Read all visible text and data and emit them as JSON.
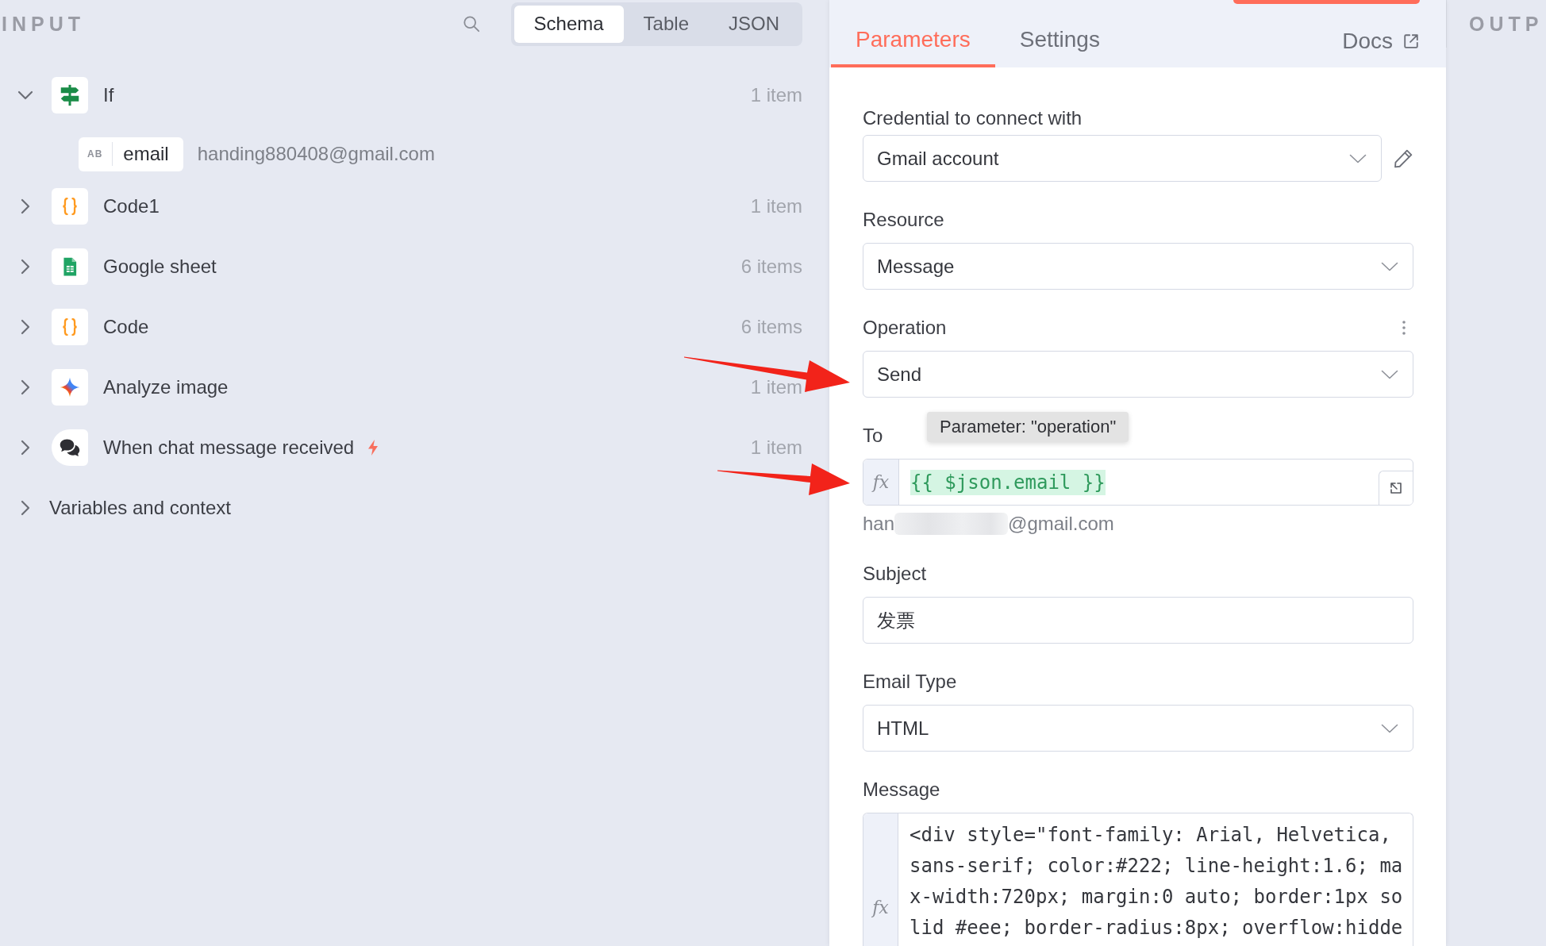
{
  "input_panel": {
    "title": "INPUT",
    "view_tabs": [
      {
        "label": "Schema",
        "selected": true
      },
      {
        "label": "Table",
        "selected": false
      },
      {
        "label": "JSON",
        "selected": false
      }
    ],
    "nodes": [
      {
        "kind": "if",
        "label": "If",
        "count": "1 item",
        "expanded": true,
        "fields": [
          {
            "type_label": "AB",
            "name": "email",
            "value": "handing880408@gmail.com"
          }
        ]
      },
      {
        "kind": "code",
        "label": "Code1",
        "count": "1 item",
        "expanded": false
      },
      {
        "kind": "sheet",
        "label": "Google sheet",
        "count": "6 items",
        "expanded": false
      },
      {
        "kind": "code",
        "label": "Code",
        "count": "6 items",
        "expanded": false
      },
      {
        "kind": "ai",
        "label": "Analyze image",
        "count": "1 item",
        "expanded": false
      },
      {
        "kind": "chat",
        "label": "When chat message received",
        "count": "1 item",
        "expanded": false,
        "trigger": true
      },
      {
        "kind": "context",
        "label": "Variables and context",
        "expanded": false
      }
    ]
  },
  "parameters_panel": {
    "tabs": [
      {
        "label": "Parameters",
        "selected": true
      },
      {
        "label": "Settings",
        "selected": false
      }
    ],
    "docs_link": "Docs",
    "fields": [
      {
        "kind": "select",
        "label": "Credential to connect with",
        "value": "Gmail account",
        "editable": true
      },
      {
        "kind": "select",
        "label": "Resource",
        "value": "Message"
      },
      {
        "kind": "select",
        "label": "Operation",
        "value": "Send",
        "options_menu": true,
        "tooltip": "Parameter: \"operation\""
      },
      {
        "kind": "expression",
        "label": "To",
        "mode_label": "fx",
        "expression": "{{ $json.email }}",
        "preview": {
          "start": "han",
          "end": "@gmail.com",
          "redacted": true
        }
      },
      {
        "kind": "text",
        "label": "Subject",
        "value": "发票"
      },
      {
        "kind": "select",
        "label": "Email Type",
        "value": "HTML"
      },
      {
        "kind": "code",
        "label": "Message",
        "mode_label": "fx",
        "value": "<div style=\"font-family: Arial, Helvetica, sans-serif; color:#222; line-height:1.6; max-width:720px; margin:0 auto; border:1px solid #eee; border-radius:8px; overflow:hidde"
      }
    ]
  },
  "output_panel": {
    "title": "OUTP"
  }
}
